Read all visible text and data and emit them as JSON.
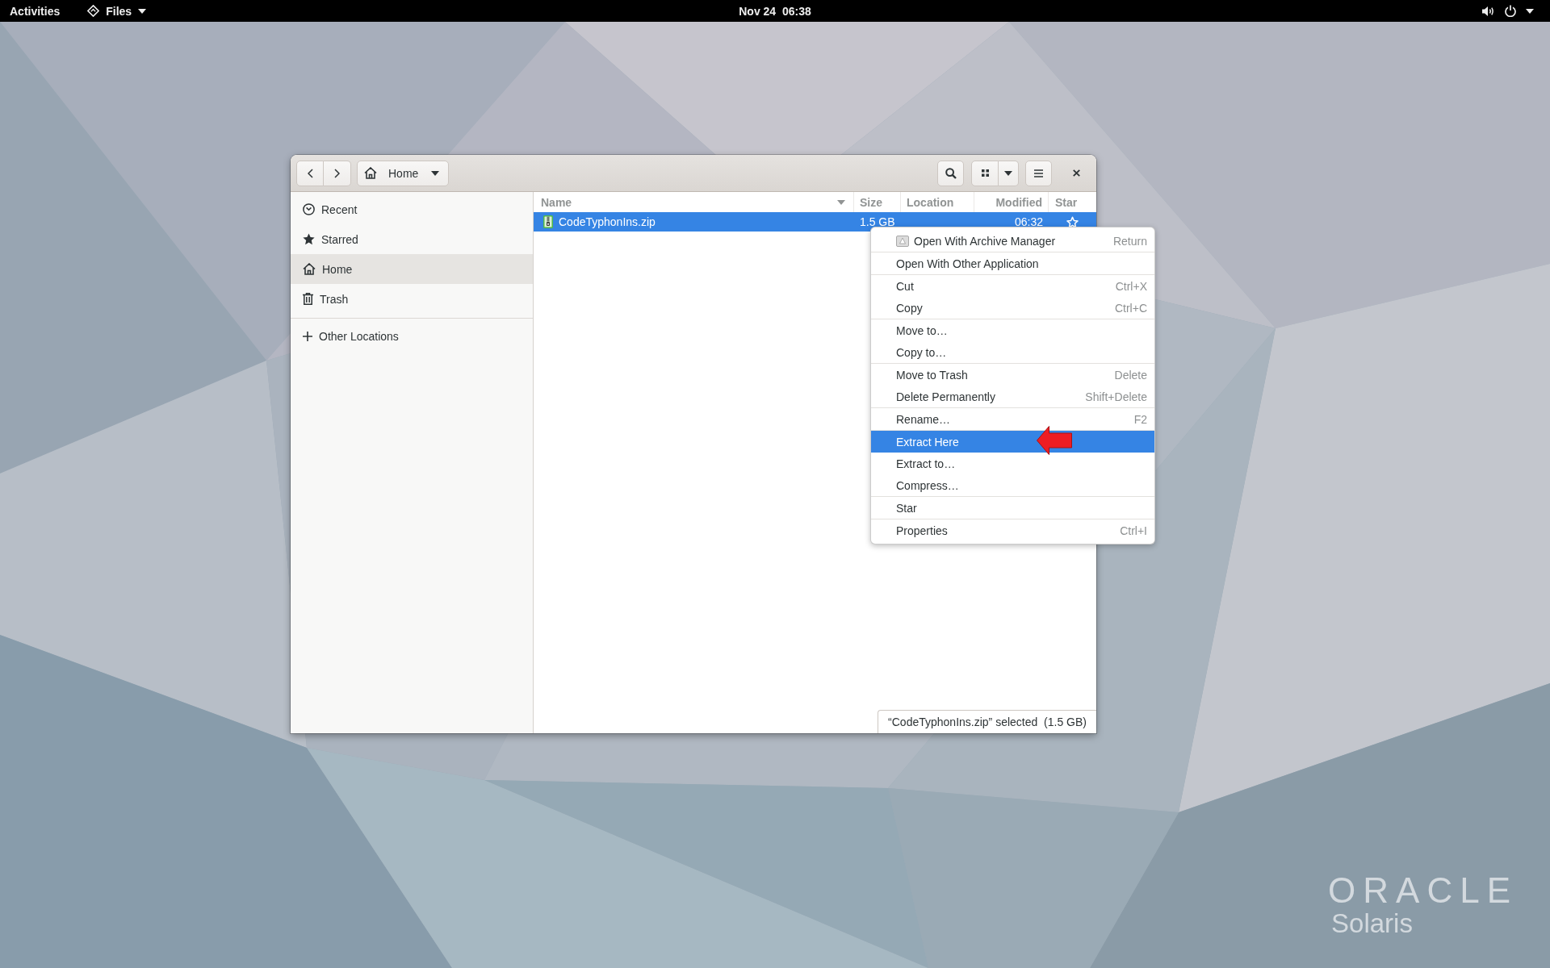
{
  "top_bar": {
    "activities": "Activities",
    "app_menu": "Files",
    "clock": "Nov 24  06:38"
  },
  "window": {
    "header_bar": {
      "location": "Home"
    },
    "sidebar": {
      "sections": [
        {
          "items": [
            {
              "kind": "recent",
              "label": "Recent",
              "selected": false
            },
            {
              "kind": "starred",
              "label": "Starred",
              "selected": false
            },
            {
              "kind": "home",
              "label": "Home",
              "selected": true
            },
            {
              "kind": "trash",
              "label": "Trash",
              "selected": false
            }
          ]
        },
        {
          "items": [
            {
              "kind": "other",
              "label": "Other Locations",
              "selected": false
            }
          ]
        }
      ]
    },
    "file_list": {
      "columns": [
        {
          "label": "Name",
          "sorted": true
        },
        {
          "label": "Size",
          "sorted": false
        },
        {
          "label": "Location",
          "sorted": false
        },
        {
          "label": "Modified",
          "sorted": false
        },
        {
          "label": "Star",
          "sorted": false
        }
      ],
      "rows": [
        {
          "name": "CodeTyphonIns.zip",
          "size": "1.5 GB",
          "modified": "06:32",
          "starred": false,
          "selected": true
        }
      ]
    },
    "status": "“CodeTyphonIns.zip” selected  (1.5 GB)"
  },
  "context_menu": {
    "sections": [
      {
        "items": [
          {
            "kind": "app",
            "label": "Open With Archive Manager",
            "shortcut": "Return",
            "selected": false
          }
        ]
      },
      {
        "items": [
          {
            "kind": "command",
            "label": "Open With Other Application",
            "selected": false
          }
        ]
      },
      {
        "items": [
          {
            "kind": "command",
            "label": "Cut",
            "shortcut": "Ctrl+X",
            "selected": false
          },
          {
            "kind": "command",
            "label": "Copy",
            "shortcut": "Ctrl+C",
            "selected": false
          }
        ]
      },
      {
        "items": [
          {
            "kind": "command",
            "label": "Move to…",
            "selected": false
          },
          {
            "kind": "command",
            "label": "Copy to…",
            "selected": false
          }
        ]
      },
      {
        "items": [
          {
            "kind": "command",
            "label": "Move to Trash",
            "shortcut": "Delete",
            "selected": false
          },
          {
            "kind": "command",
            "label": "Delete Permanently",
            "shortcut": "Shift+Delete",
            "selected": false
          }
        ]
      },
      {
        "items": [
          {
            "kind": "command",
            "label": "Rename…",
            "shortcut": "F2",
            "selected": false
          }
        ]
      },
      {
        "items": [
          {
            "kind": "command",
            "label": "Extract Here",
            "selected": true
          },
          {
            "kind": "command",
            "label": "Extract to…",
            "selected": false
          },
          {
            "kind": "command",
            "label": "Compress…",
            "selected": false
          }
        ]
      },
      {
        "items": [
          {
            "kind": "command",
            "label": "Star",
            "selected": false
          }
        ]
      },
      {
        "items": [
          {
            "kind": "command",
            "label": "Properties",
            "shortcut": "Ctrl+I",
            "selected": false
          }
        ]
      }
    ]
  },
  "wallpaper": {
    "brand": "ORACLE",
    "product": "Solaris"
  }
}
